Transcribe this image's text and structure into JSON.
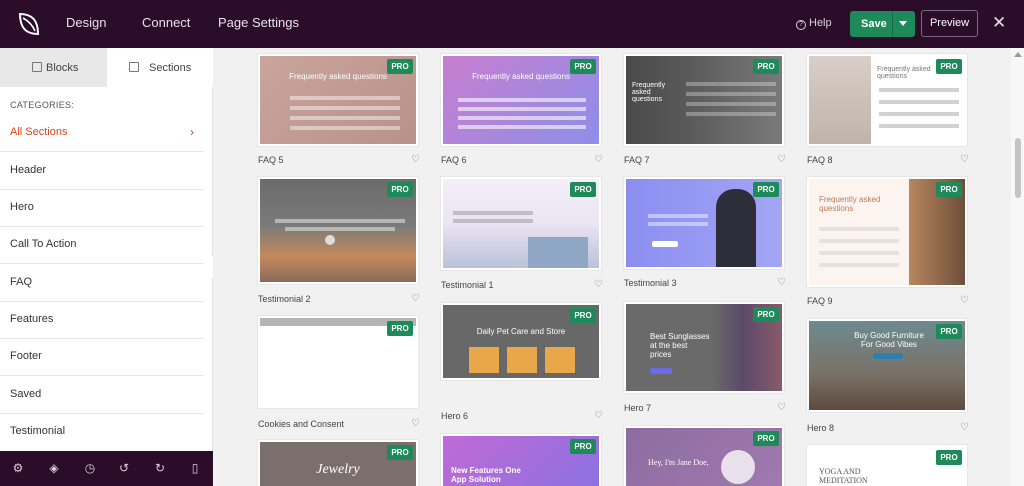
{
  "topbar": {
    "nav": [
      "Design",
      "Connect",
      "Page Settings"
    ],
    "help_label": "Help",
    "save_label": "Save",
    "preview_label": "Preview"
  },
  "sidebar": {
    "tabs": [
      "Blocks",
      "Sections"
    ],
    "categories_title": "CATEGORIES:",
    "categories": [
      "All Sections",
      "Header",
      "Hero",
      "Call To Action",
      "FAQ",
      "Features",
      "Footer",
      "Saved",
      "Testimonial"
    ]
  },
  "bottombar_icons": [
    "settings-icon",
    "layers-icon",
    "history-icon",
    "undo-icon",
    "redo-icon",
    "mobile-preview-icon"
  ],
  "badge": "PRO",
  "templates": [
    {
      "caption": "FAQ 5",
      "title": "Frequently asked questions"
    },
    {
      "caption": "FAQ 6",
      "title": "Frequently asked questions"
    },
    {
      "caption": "FAQ 7",
      "title": "Frequently asked questions"
    },
    {
      "caption": "FAQ 8",
      "title": "Frequently asked questions"
    },
    {
      "caption": "Testimonial 2",
      "title": ""
    },
    {
      "caption": "Testimonial 1",
      "title": ""
    },
    {
      "caption": "Testimonial 3",
      "title": ""
    },
    {
      "caption": "FAQ 9",
      "title": "Frequently asked questions"
    },
    {
      "caption": "Cookies and Consent",
      "title": ""
    },
    {
      "caption": "Hero 6",
      "title": "Daily Pet Care and Store"
    },
    {
      "caption": "Hero 7",
      "title": "Best Sunglasses at the best prices"
    },
    {
      "caption": "Hero 8",
      "title": "Buy Good Furniture For Good Vibes"
    },
    {
      "caption": "",
      "title": "Jewelry"
    },
    {
      "caption": "",
      "title": "New Features One App Solution"
    },
    {
      "caption": "",
      "title": "Hey, I'm Jane Doe,"
    },
    {
      "caption": "",
      "title": "YOGA AND MEDITATION"
    }
  ],
  "colors": {
    "topbar": "#2b0d2a",
    "accent": "#d4471c",
    "save": "#1e8a5a"
  }
}
